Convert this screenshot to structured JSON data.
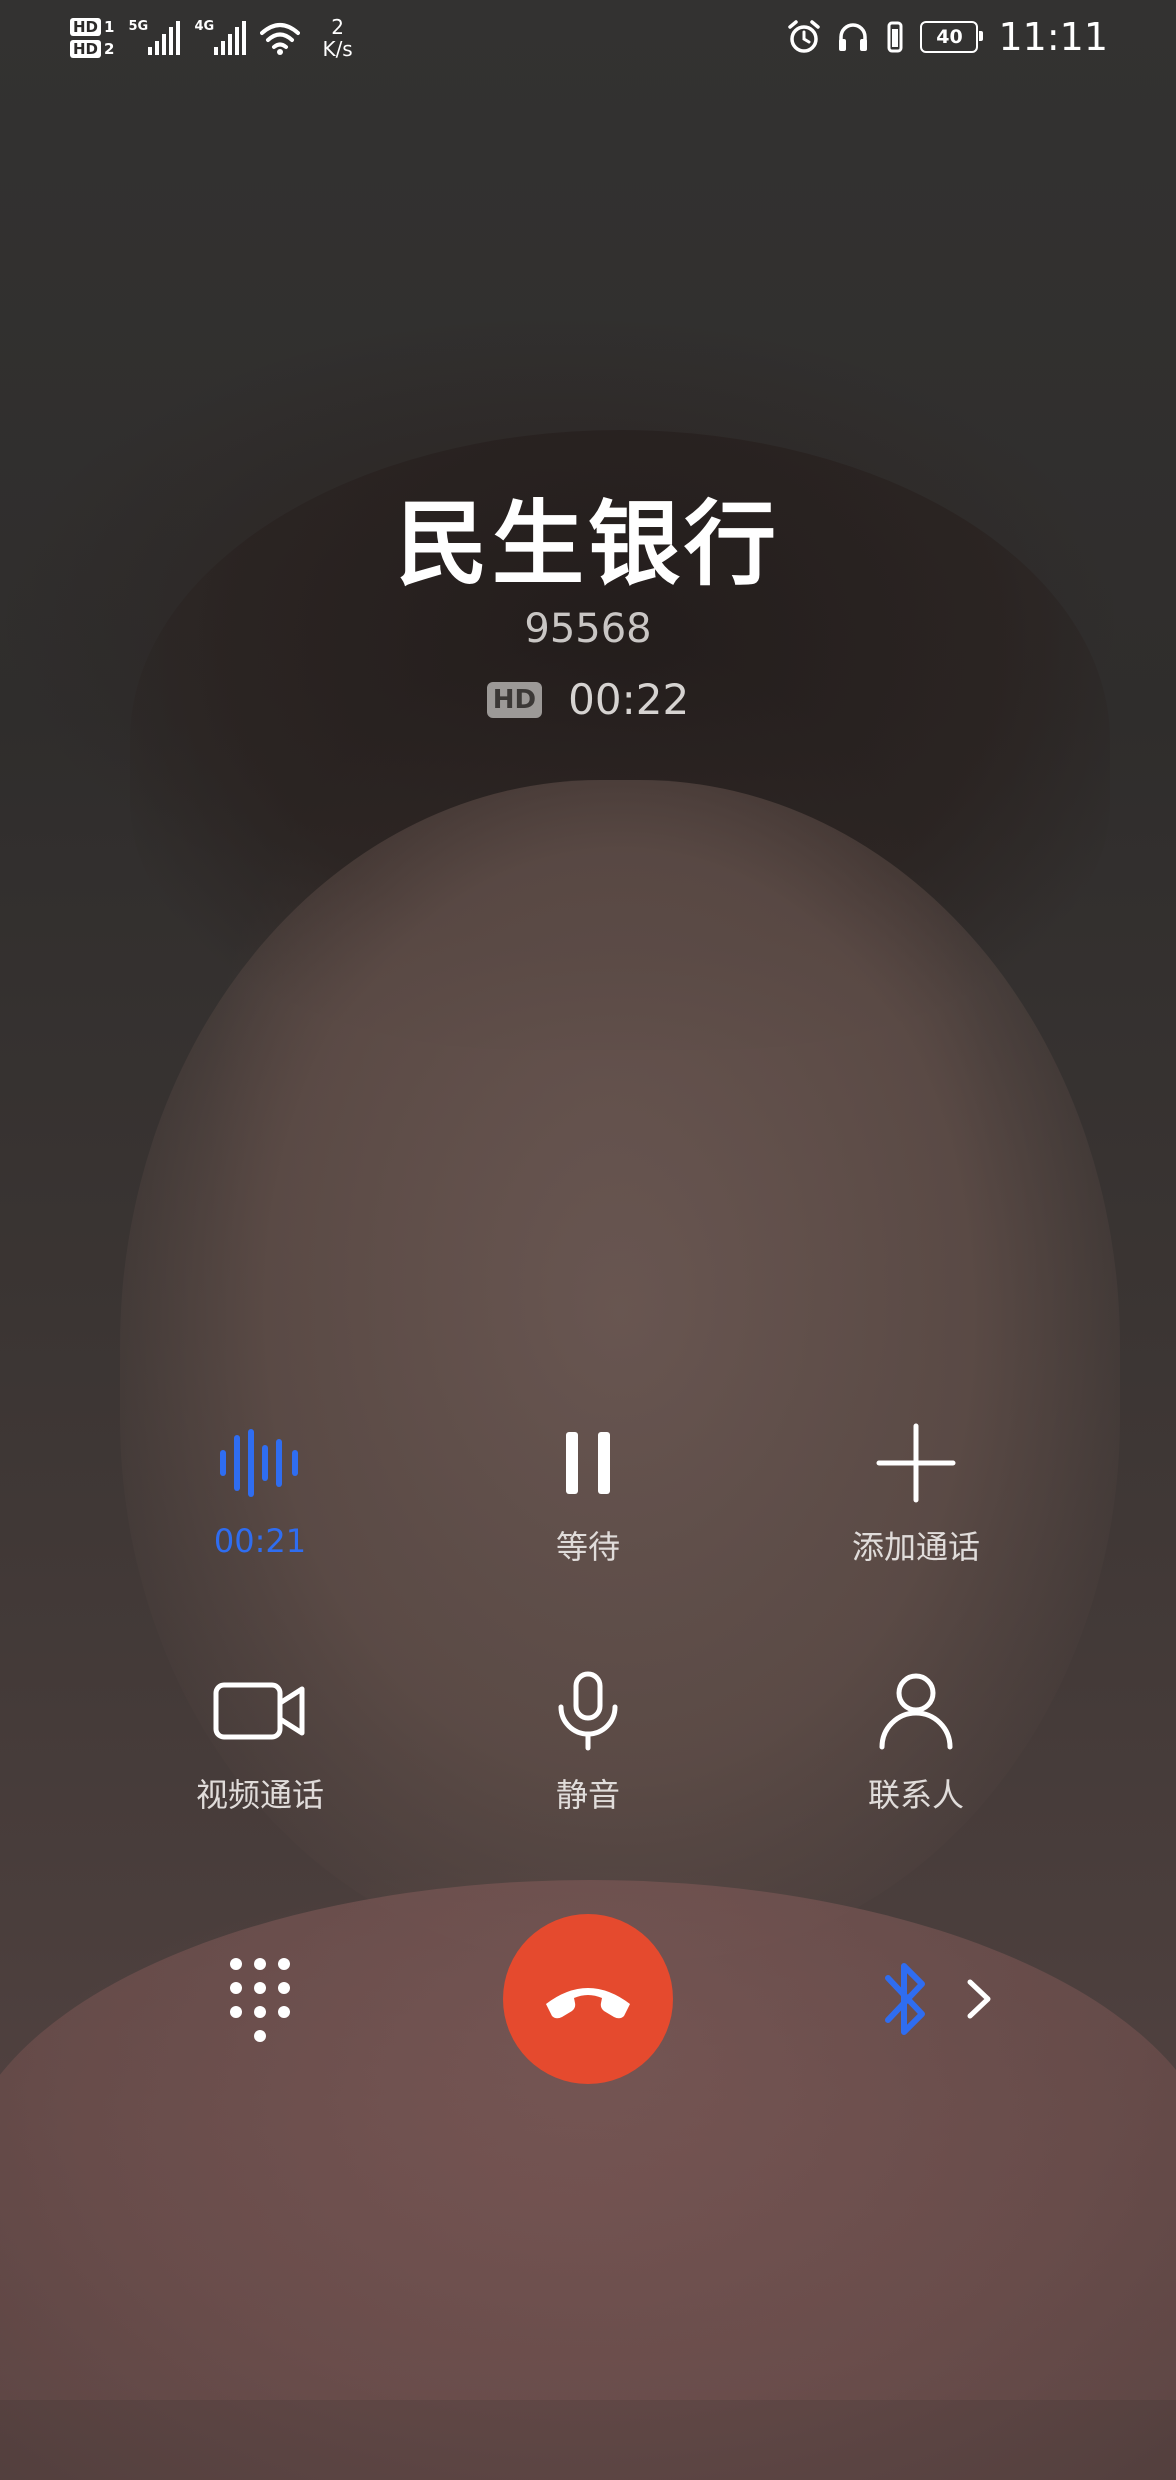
{
  "status_bar": {
    "sim1": "HD",
    "sim1_num": "1",
    "sim2": "HD",
    "sim2_num": "2",
    "net1": "5G",
    "net2": "4G",
    "speed_value": "2",
    "speed_unit": "K/s",
    "battery": "40",
    "time": "11:11"
  },
  "caller": {
    "name": "民生银行",
    "number": "95568",
    "hd_badge": "HD",
    "duration": "00:22"
  },
  "actions": {
    "record_time": "00:21",
    "hold": "等待",
    "add_call": "添加通话",
    "video_call": "视频通话",
    "mute": "静音",
    "contacts": "联系人"
  },
  "colors": {
    "end_call": "#e54a2e",
    "accent_blue": "#2f6df0"
  },
  "icons": [
    "sound-wave-icon",
    "pause-icon",
    "plus-icon",
    "video-camera-icon",
    "microphone-icon",
    "person-icon",
    "dialpad-icon",
    "phone-hangup-icon",
    "bluetooth-icon",
    "chevron-right-icon"
  ]
}
